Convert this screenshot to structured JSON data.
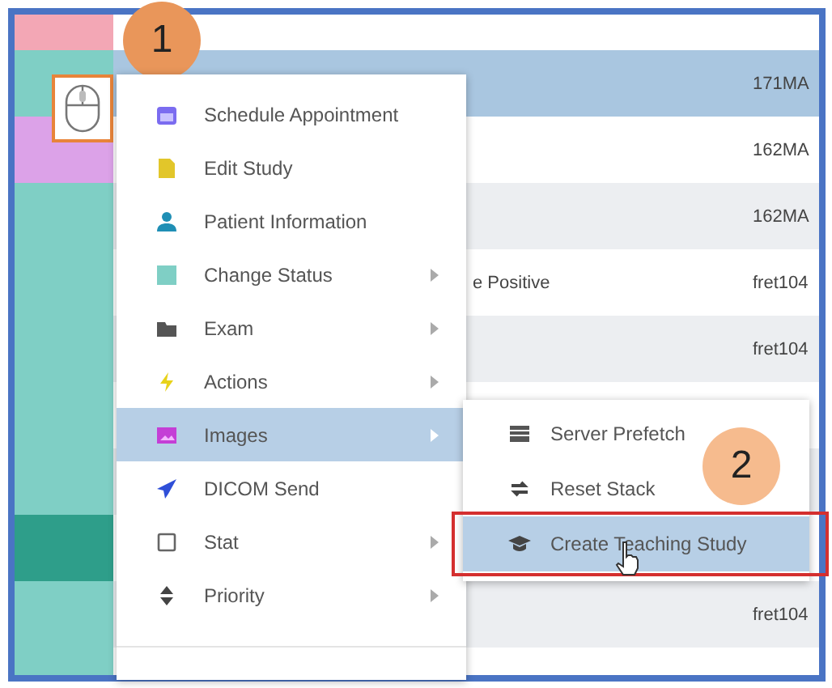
{
  "worklist": {
    "rows": [
      {
        "color": "#f3a7b5",
        "selected": false
      },
      {
        "color": "#7fcfc5",
        "selected": true,
        "accession": "171MA"
      },
      {
        "color": "#dca2e8",
        "selected": false,
        "accession": "162MA"
      },
      {
        "color": "#7fcfc5",
        "selected": false,
        "accession": "162MA"
      },
      {
        "color": "#7fcfc5",
        "selected": false,
        "status": "e Positive",
        "accession": "fret104"
      },
      {
        "color": "#7fcfc5",
        "selected": false,
        "accession": "fret104"
      },
      {
        "color": "#7fcfc5",
        "selected": false
      },
      {
        "color": "#7fcfc5",
        "selected": false
      },
      {
        "color": "#2e9e8a",
        "selected": false
      },
      {
        "color": "#7fcfc5",
        "selected": false,
        "accession": "fret104"
      },
      {
        "color": "#7fcfc5",
        "selected": false
      }
    ]
  },
  "mouse_callout": {
    "badge": "1"
  },
  "context_menu": {
    "items": [
      {
        "label": "Schedule Appointment",
        "has_submenu": false,
        "selected": false
      },
      {
        "label": "Edit Study",
        "has_submenu": false,
        "selected": false
      },
      {
        "label": "Patient Information",
        "has_submenu": false,
        "selected": false
      },
      {
        "label": "Change Status",
        "has_submenu": true,
        "selected": false
      },
      {
        "label": "Exam",
        "has_submenu": true,
        "selected": false
      },
      {
        "label": "Actions",
        "has_submenu": true,
        "selected": false
      },
      {
        "label": "Images",
        "has_submenu": true,
        "selected": true
      },
      {
        "label": "DICOM Send",
        "has_submenu": false,
        "selected": false
      },
      {
        "label": "Stat",
        "has_submenu": true,
        "selected": false
      },
      {
        "label": "Priority",
        "has_submenu": true,
        "selected": false
      }
    ]
  },
  "submenu": {
    "items": [
      {
        "label": "Server Prefetch",
        "selected": false
      },
      {
        "label": "Reset Stack",
        "selected": false
      },
      {
        "label": "Create Teaching Study",
        "selected": true
      }
    ]
  },
  "step_badge": "2"
}
